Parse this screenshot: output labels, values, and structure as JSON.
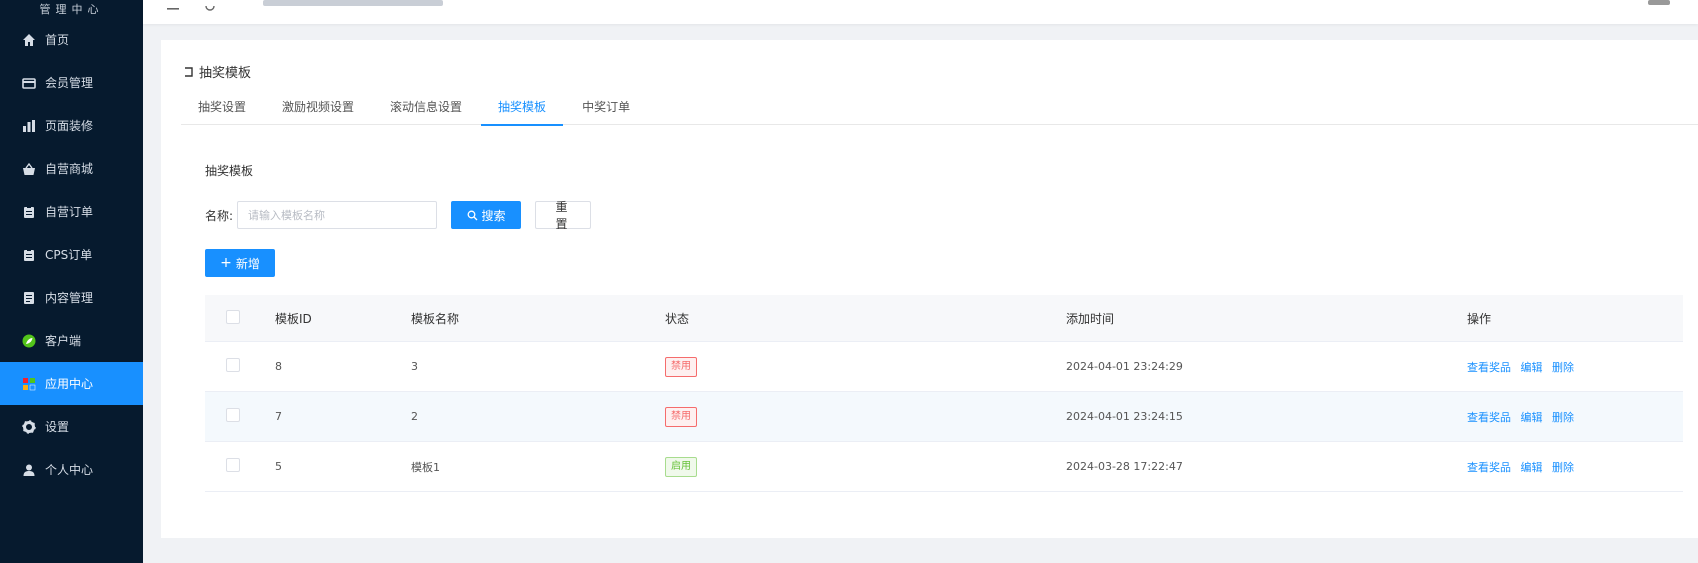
{
  "sidebar": {
    "brand": "管理中心",
    "items": [
      {
        "label": "首页",
        "icon": "home-icon"
      },
      {
        "label": "会员管理",
        "icon": "card-icon"
      },
      {
        "label": "页面装修",
        "icon": "bar-chart-icon"
      },
      {
        "label": "自营商城",
        "icon": "basket-icon"
      },
      {
        "label": "自营订单",
        "icon": "clipboard-icon"
      },
      {
        "label": "CPS订单",
        "icon": "clipboard-icon"
      },
      {
        "label": "内容管理",
        "icon": "document-icon"
      },
      {
        "label": "客户端",
        "icon": "leaf-icon"
      },
      {
        "label": "应用中心",
        "icon": "apps-icon",
        "active": true
      },
      {
        "label": "设置",
        "icon": "gear-icon"
      },
      {
        "label": "个人中心",
        "icon": "user-icon"
      }
    ]
  },
  "page": {
    "title": "抽奖模板",
    "tabs": [
      "抽奖设置",
      "激励视频设置",
      "滚动信息设置",
      "抽奖模板",
      "中奖订单"
    ],
    "active_tab": 3,
    "section_title": "抽奖模板"
  },
  "search": {
    "label": "名称:",
    "placeholder": "请输入模板名称",
    "value": "",
    "search_label": "搜索",
    "reset_label": "重置",
    "add_label": "新增"
  },
  "table": {
    "columns": [
      "模板ID",
      "模板名称",
      "状态",
      "添加时间",
      "操作"
    ],
    "rows": [
      {
        "id": "8",
        "name": "3",
        "status": "禁用",
        "status_type": "off",
        "time": "2024-04-01 23:24:29",
        "actions": [
          "查看奖品",
          "编辑",
          "删除"
        ]
      },
      {
        "id": "7",
        "name": "2",
        "status": "禁用",
        "status_type": "off",
        "time": "2024-04-01 23:24:15",
        "actions": [
          "查看奖品",
          "编辑",
          "删除"
        ]
      },
      {
        "id": "5",
        "name": "模板1",
        "status": "启用",
        "status_type": "on",
        "time": "2024-03-28 17:22:47",
        "actions": [
          "查看奖品",
          "编辑",
          "删除"
        ]
      }
    ]
  },
  "colors": {
    "sidebar_bg": "#061a2e",
    "primary": "#1890ff",
    "danger": "#f56c6c",
    "success": "#67c23a"
  }
}
